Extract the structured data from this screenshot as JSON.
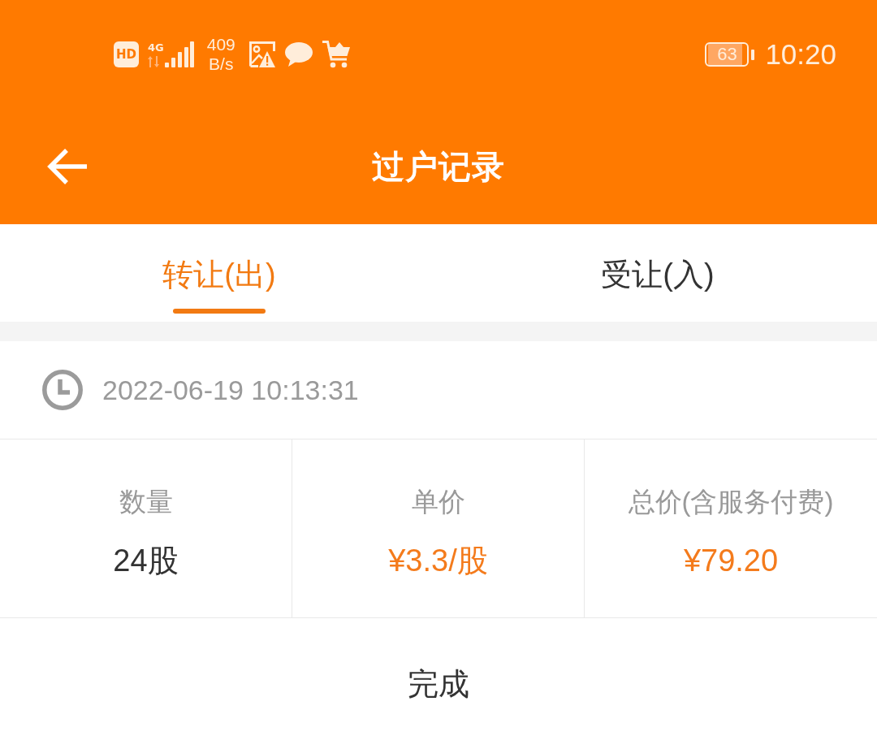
{
  "status_bar": {
    "hd_label": "HD",
    "network_type": "4G",
    "speed": {
      "value": "409",
      "unit": "B/s"
    },
    "battery": "63",
    "time": "10:20"
  },
  "header": {
    "title": "过户记录"
  },
  "tabs": [
    {
      "label": "转让(出)",
      "selected": true
    },
    {
      "label": "受让(入)",
      "selected": false
    }
  ],
  "record": {
    "time": "2022-06-19 10:13:31",
    "stats": [
      {
        "label": "数量",
        "value": "24股",
        "highlight": false
      },
      {
        "label": "单价",
        "value": "¥3.3/股",
        "highlight": true
      },
      {
        "label": "总价(含服务付费)",
        "value": "¥79.20",
        "highlight": true
      }
    ],
    "status": "完成"
  }
}
